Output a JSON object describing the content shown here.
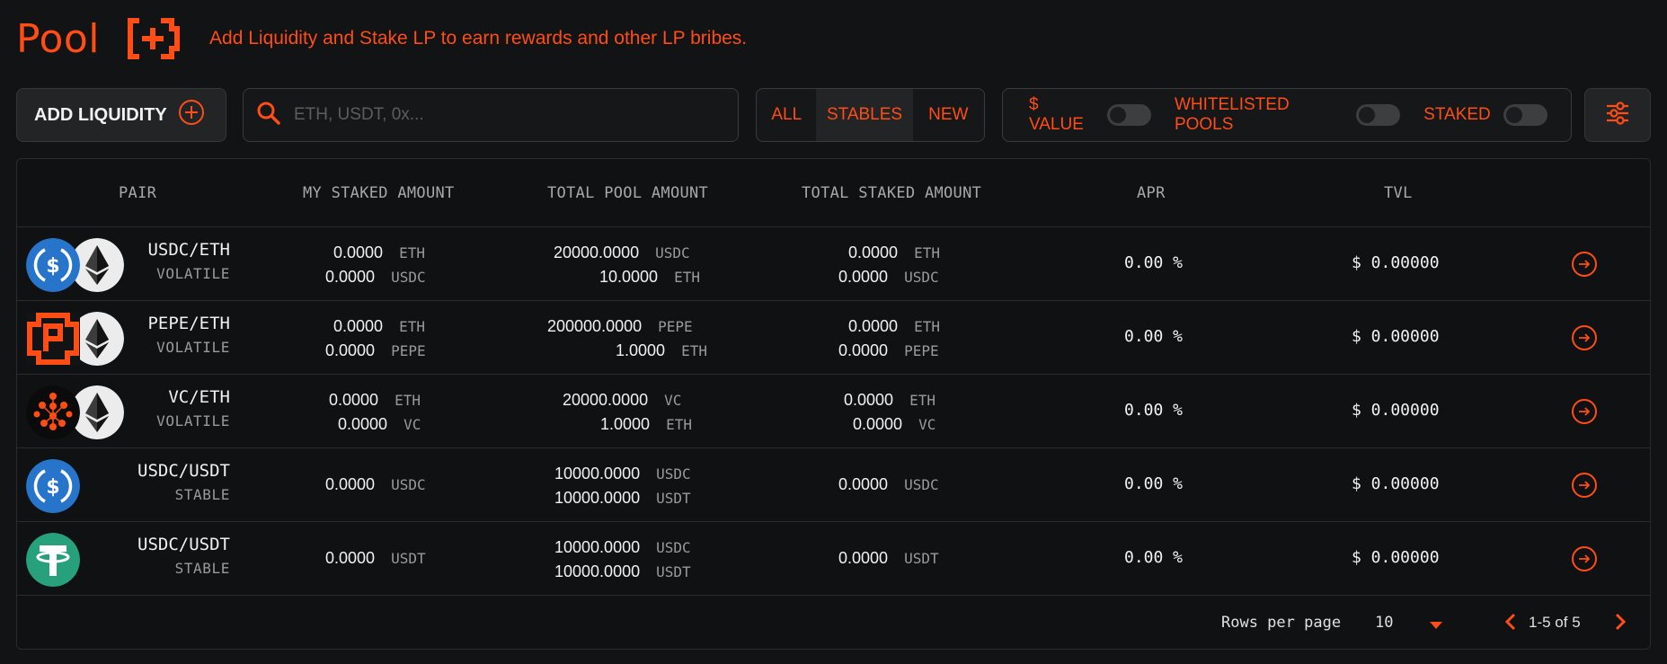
{
  "header": {
    "title": "Pool",
    "tagline": "Add Liquidity and Stake LP to earn rewards and other LP bribes."
  },
  "toolbar": {
    "add_liquidity_label": "ADD LIQUIDITY",
    "search_placeholder": "ETH, USDT, 0x...",
    "filters": [
      "ALL",
      "STABLES",
      "NEW"
    ],
    "selected_filter": "STABLES",
    "toggles": [
      {
        "label": "$ VALUE",
        "on": false
      },
      {
        "label": "WHITELISTED POOLS",
        "on": false
      },
      {
        "label": "STAKED",
        "on": false
      }
    ]
  },
  "table": {
    "columns": [
      "PAIR",
      "MY STAKED AMOUNT",
      "TOTAL POOL AMOUNT",
      "TOTAL STAKED AMOUNT",
      "APR",
      "TVL"
    ],
    "rows": [
      {
        "icons": [
          "usdc-icon",
          "eth-icon"
        ],
        "pair": "USDC/ETH",
        "type": "VOLATILE",
        "my_staked": [
          {
            "value": "0.0000",
            "unit": "ETH"
          },
          {
            "value": "0.0000",
            "unit": "USDC"
          }
        ],
        "total_pool": [
          {
            "value": "20000.0000",
            "unit": "USDC"
          },
          {
            "value": "10.0000",
            "unit": "ETH"
          }
        ],
        "total_staked": [
          {
            "value": "0.0000",
            "unit": "ETH"
          },
          {
            "value": "0.0000",
            "unit": "USDC"
          }
        ],
        "apr": "0.00 %",
        "tvl": "$ 0.00000"
      },
      {
        "icons": [
          "pepe-icon",
          "eth-icon"
        ],
        "pair": "PEPE/ETH",
        "type": "VOLATILE",
        "my_staked": [
          {
            "value": "0.0000",
            "unit": "ETH"
          },
          {
            "value": "0.0000",
            "unit": "PEPE"
          }
        ],
        "total_pool": [
          {
            "value": "200000.0000",
            "unit": "PEPE"
          },
          {
            "value": "1.0000",
            "unit": "ETH"
          }
        ],
        "total_staked": [
          {
            "value": "0.0000",
            "unit": "ETH"
          },
          {
            "value": "0.0000",
            "unit": "PEPE"
          }
        ],
        "apr": "0.00 %",
        "tvl": "$ 0.00000"
      },
      {
        "icons": [
          "vc-icon",
          "eth-icon"
        ],
        "pair": "VC/ETH",
        "type": "VOLATILE",
        "my_staked": [
          {
            "value": "0.0000",
            "unit": "ETH"
          },
          {
            "value": "0.0000",
            "unit": "VC"
          }
        ],
        "total_pool": [
          {
            "value": "20000.0000",
            "unit": "VC"
          },
          {
            "value": "1.0000",
            "unit": "ETH"
          }
        ],
        "total_staked": [
          {
            "value": "0.0000",
            "unit": "ETH"
          },
          {
            "value": "0.0000",
            "unit": "VC"
          }
        ],
        "apr": "0.00 %",
        "tvl": "$ 0.00000"
      },
      {
        "icons": [
          "usdc-icon"
        ],
        "pair": "USDC/USDT",
        "type": "STABLE",
        "my_staked": [
          {
            "value": "0.0000",
            "unit": "USDC"
          }
        ],
        "total_pool": [
          {
            "value": "10000.0000",
            "unit": "USDC"
          },
          {
            "value": "10000.0000",
            "unit": "USDT"
          }
        ],
        "total_staked": [
          {
            "value": "0.0000",
            "unit": "USDC"
          }
        ],
        "apr": "0.00 %",
        "tvl": "$ 0.00000"
      },
      {
        "icons": [
          "usdt-icon"
        ],
        "pair": "USDC/USDT",
        "type": "STABLE",
        "my_staked": [
          {
            "value": "0.0000",
            "unit": "USDT"
          }
        ],
        "total_pool": [
          {
            "value": "10000.0000",
            "unit": "USDC"
          },
          {
            "value": "10000.0000",
            "unit": "USDT"
          }
        ],
        "total_staked": [
          {
            "value": "0.0000",
            "unit": "USDT"
          }
        ],
        "apr": "0.00 %",
        "tvl": "$ 0.00000"
      }
    ]
  },
  "pagination": {
    "rows_per_page_label": "Rows per page",
    "rows_per_page": "10",
    "range": "1-5 of 5"
  },
  "colors": {
    "accent": "#ff4d15",
    "background": "#121314",
    "usdc": "#2775ca",
    "usdt": "#26a17b"
  }
}
